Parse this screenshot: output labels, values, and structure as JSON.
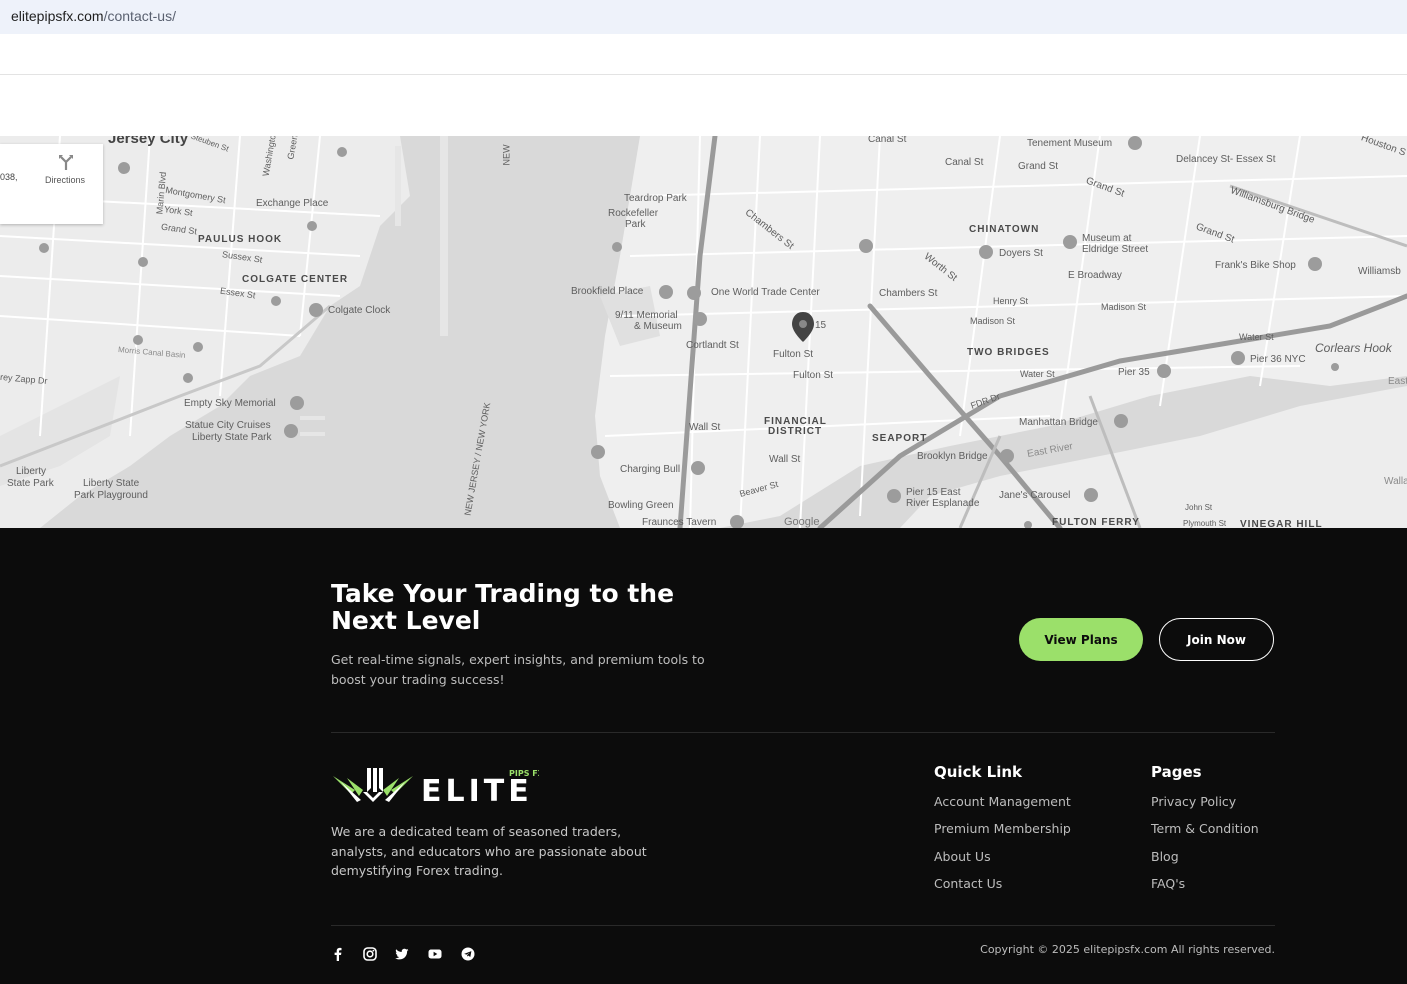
{
  "browser": {
    "url_host": "elitepipsfx.com",
    "url_path": "/contact-us/"
  },
  "map": {
    "directions_label": "Directions",
    "address_fragment": "038,",
    "attribution": "Google",
    "labels": {
      "jersey_city": "Jersey City",
      "steuben": "Steuben St",
      "washington": "Washington",
      "green": "Green",
      "marin": "Marin Blvd",
      "montgomery": "Montgomery St",
      "york": "York St",
      "exchange_place": "Exchange Place",
      "grand_st_w": "Grand St",
      "paulus_hook": "PAULUS HOOK",
      "sussex": "Sussex St",
      "colgate_center": "COLGATE CENTER",
      "essex": "Essex St",
      "colgate_clock": "Colgate Clock",
      "morris_canal": "Morris Canal Basin",
      "zapp": "rey Zapp Dr",
      "empty_sky": "Empty Sky Memorial",
      "statue_cruises_1": "Statue City Cruises",
      "statue_cruises_2": "Liberty State Park",
      "liberty_sp_1": "Liberty",
      "liberty_sp_2": "State Park",
      "liberty_pg_1": "Liberty State",
      "liberty_pg_2": "Park Playground",
      "ny_top": "NEW",
      "nj_border": "NEW JERSEY / NEW YORK",
      "teardrop_1": "Teardrop Park",
      "rockefeller_1": "Rockefeller",
      "rockefeller_2": "Park",
      "brookfield": "Brookfield Place",
      "memorial_1": "9/11 Memorial",
      "memorial_2": "& Museum",
      "wtc": "One World Trade Center",
      "cortlandt": "Cortlandt St",
      "fulton1": "Fulton St",
      "fulton2": "Fulton St",
      "wall1": "Wall St",
      "wall2": "Wall St",
      "financial_1": "FINANCIAL",
      "financial_2": "DISTRICT",
      "seaport": "SEAPORT",
      "charging_bull": "Charging Bull",
      "bowling_green": "Bowling Green",
      "fraunces": "Fraunces Tavern",
      "beaver": "Beaver St",
      "canal_top": "Canal St",
      "canal2": "Canal St",
      "chambers_left": "Chambers St",
      "chambers_right": "Chambers St",
      "chinatown": "CHINATOWN",
      "doyers": "Doyers St",
      "worth": "Worth St",
      "tenement": "Tenement Museum",
      "delancey": "Delancey St- Essex St",
      "grand_top": "Grand St",
      "grand_mid": "Grand St",
      "grand_right": "Grand St",
      "museum_eldridge_1": "Museum at",
      "museum_eldridge_2": "Eldridge Street",
      "e_broadway": "E Broadway",
      "henry": "Henry St",
      "madison": "Madison St",
      "madison2": "Madison St",
      "two_bridges": "TWO BRIDGES",
      "water": "Water St",
      "water2": "Water St",
      "pier35": "Pier 35",
      "pier36": "Pier 36 NYC",
      "corlears": "Corlears Hook",
      "franks": "Frank's Bike Shop",
      "williamsburg": "Williamsburg Bridge",
      "williamsb": "Williamsb",
      "houston": "Houston S",
      "fdr": "FDR Dr",
      "manhattan_bridge": "Manhattan Bridge",
      "brooklyn_bridge": "Brooklyn Bridge",
      "east_river": "East River",
      "pier15_1": "Pier 15 East",
      "pier15_2": "River Esplanade",
      "janes": "Jane's Carousel",
      "fulton_ferry": "FULTON FERRY",
      "vinegar": "VINEGAR HILL",
      "john_st": "John St",
      "plymouth": "Plymouth St",
      "east_edge": "East",
      "walla": "Walla",
      "pin_number": "15"
    }
  },
  "cta": {
    "title": "Take Your Trading to the Next Level",
    "text": "Get real-time signals, expert insights, and premium tools to boost your trading success!",
    "view_plans": "View Plans",
    "join_now": "Join Now"
  },
  "brand": {
    "logo_text": "ELITE",
    "logo_sub": "PIPS FX",
    "accent": "#9be06a",
    "about": "We are a dedicated team of seasoned traders, analysts, and educators who are passionate about demystifying Forex trading."
  },
  "quick_link": {
    "heading": "Quick Link",
    "items": [
      "Account Management",
      "Premium Membership",
      "About Us",
      "Contact Us"
    ]
  },
  "pages": {
    "heading": "Pages",
    "items": [
      "Privacy Policy",
      "Term & Condition",
      "Blog",
      "FAQ's"
    ]
  },
  "social": [
    "facebook-icon",
    "instagram-icon",
    "twitter-icon",
    "youtube-icon",
    "telegram-icon"
  ],
  "copyright": "Copyright © 2025 elitepipsfx.com All rights reserved."
}
